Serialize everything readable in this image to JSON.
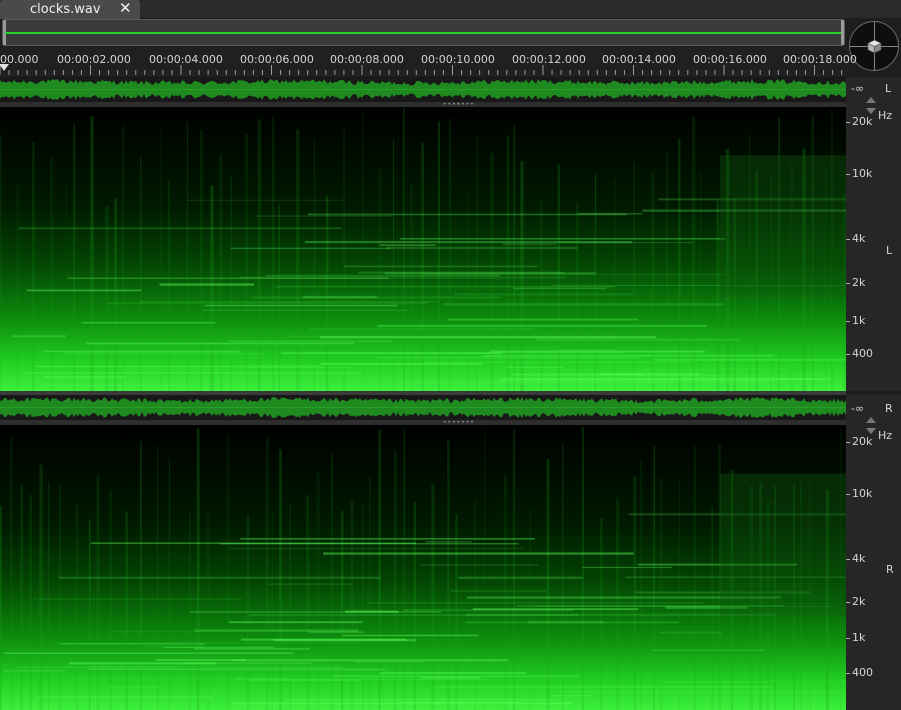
{
  "tab": {
    "title": "clocks.wav",
    "close_glyph": "✕"
  },
  "icons": {
    "close": "close-icon",
    "zoom": "cube-icon",
    "playhead": "playhead-marker-icon"
  },
  "colors": {
    "accent_green": "#27d227",
    "waveform": "#1f8a1f",
    "background": "#1e1e1e"
  },
  "ruler": {
    "labels": [
      "00.000",
      "00:00:02.000",
      "00:00:04.000",
      "00:00:06.000",
      "00:00:08.000",
      "00:00:10.000",
      "00:00:12.000",
      "00:00:14.000",
      "00:00:16.000",
      "00:00:18.000"
    ]
  },
  "channels": [
    {
      "id": "L",
      "label": "L",
      "level": "-∞",
      "unit": "Hz",
      "freq_labels": [
        "20k",
        "10k",
        "4k",
        "2k",
        "1k",
        "400"
      ]
    },
    {
      "id": "R",
      "label": "R",
      "level": "-∞",
      "unit": "Hz",
      "freq_labels": [
        "20k",
        "10k",
        "4k",
        "2k",
        "1k",
        "400"
      ]
    }
  ]
}
